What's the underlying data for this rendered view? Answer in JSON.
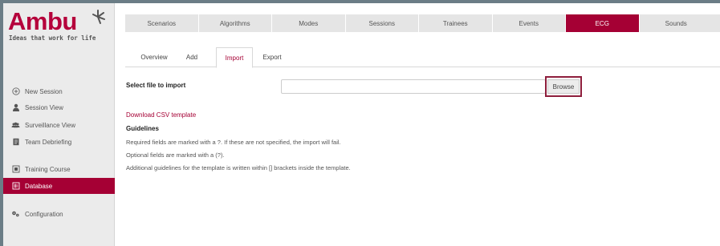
{
  "brand": {
    "name": "Ambu",
    "tagline": "Ideas that work for life",
    "color": "#b5003b"
  },
  "sidebar": {
    "items": [
      {
        "label": "New Session",
        "icon": "plus-circle-icon",
        "active": false
      },
      {
        "label": "Session View",
        "icon": "person-icon",
        "active": false
      },
      {
        "label": "Surveillance View",
        "icon": "group-icon",
        "active": false
      },
      {
        "label": "Team Debriefing",
        "icon": "document-icon",
        "active": false
      },
      {
        "label": "Training Course",
        "icon": "course-icon",
        "active": false
      },
      {
        "label": "Database",
        "icon": "database-icon",
        "active": true
      },
      {
        "label": "Configuration",
        "icon": "gears-icon",
        "active": false
      }
    ]
  },
  "tabs": [
    "Scenarios",
    "Algorithms",
    "Modes",
    "Sessions",
    "Trainees",
    "Events",
    "ECG",
    "Sounds"
  ],
  "active_tab": "ECG",
  "subtabs": [
    "Overview",
    "Add",
    "Import",
    "Export"
  ],
  "active_subtab": "Import",
  "import": {
    "select_label": "Select file to import",
    "file_value": "",
    "browse_label": "Browse"
  },
  "download_link": "Download CSV template",
  "guidelines": {
    "title": "Guidelines",
    "lines": [
      "Required fields are marked with a ?. If these are not specified, the import will fail.",
      "Optional fields are marked with a (?).",
      "Additional guidelines for the template is written within [] brackets inside the template."
    ]
  },
  "colors": {
    "accent": "#a50034",
    "sidebar_bg": "#ebebeb",
    "tab_bg": "#e5e5e5",
    "outer_bg": "#6b7d86"
  }
}
